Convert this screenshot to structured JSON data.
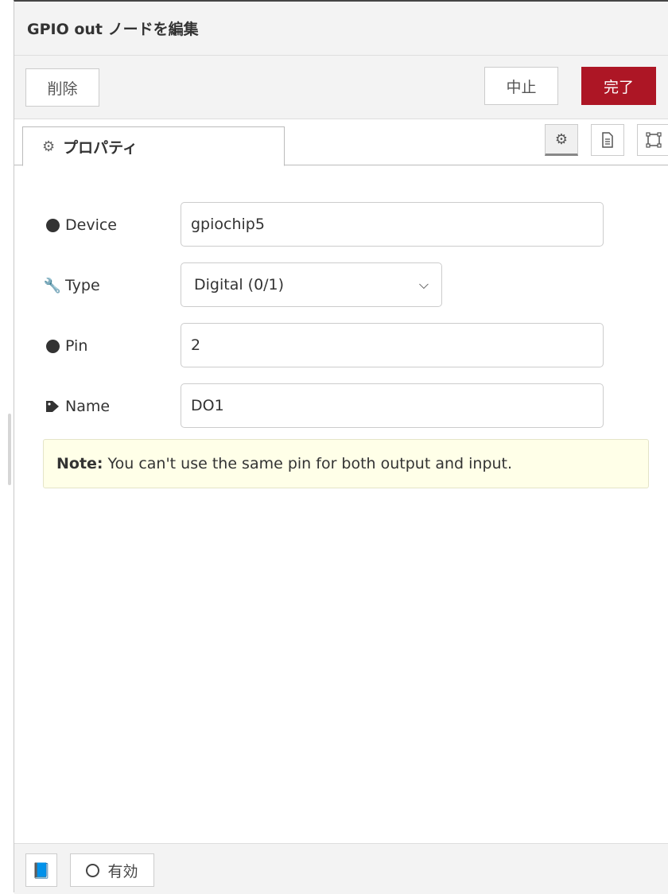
{
  "tray": {
    "title": "GPIO out ノードを編集"
  },
  "toolbar": {
    "delete_label": "削除",
    "cancel_label": "中止",
    "done_label": "完了"
  },
  "tabs": {
    "properties_label": "プロパティ",
    "properties_icon": "gear-icon",
    "right_icons": [
      "gear-icon",
      "document-icon",
      "layout-icon"
    ]
  },
  "form": {
    "device": {
      "label": "Device",
      "value": "gpiochip5",
      "icon": "circle-icon"
    },
    "type": {
      "label": "Type",
      "value": "Digital (0/1)",
      "icon": "wrench-icon"
    },
    "pin": {
      "label": "Pin",
      "value": "2",
      "icon": "circle-icon"
    },
    "name": {
      "label": "Name",
      "value": "DO1",
      "icon": "tag-icon"
    }
  },
  "note": {
    "bold": "Note:",
    "text": "You can't use the same pin for both output and input."
  },
  "footer": {
    "enable_label": "有効",
    "book_icon": "book-icon"
  },
  "colors": {
    "done": "#ad1625",
    "note_bg": "#ffffe8",
    "header_bg": "#f3f3f3"
  }
}
